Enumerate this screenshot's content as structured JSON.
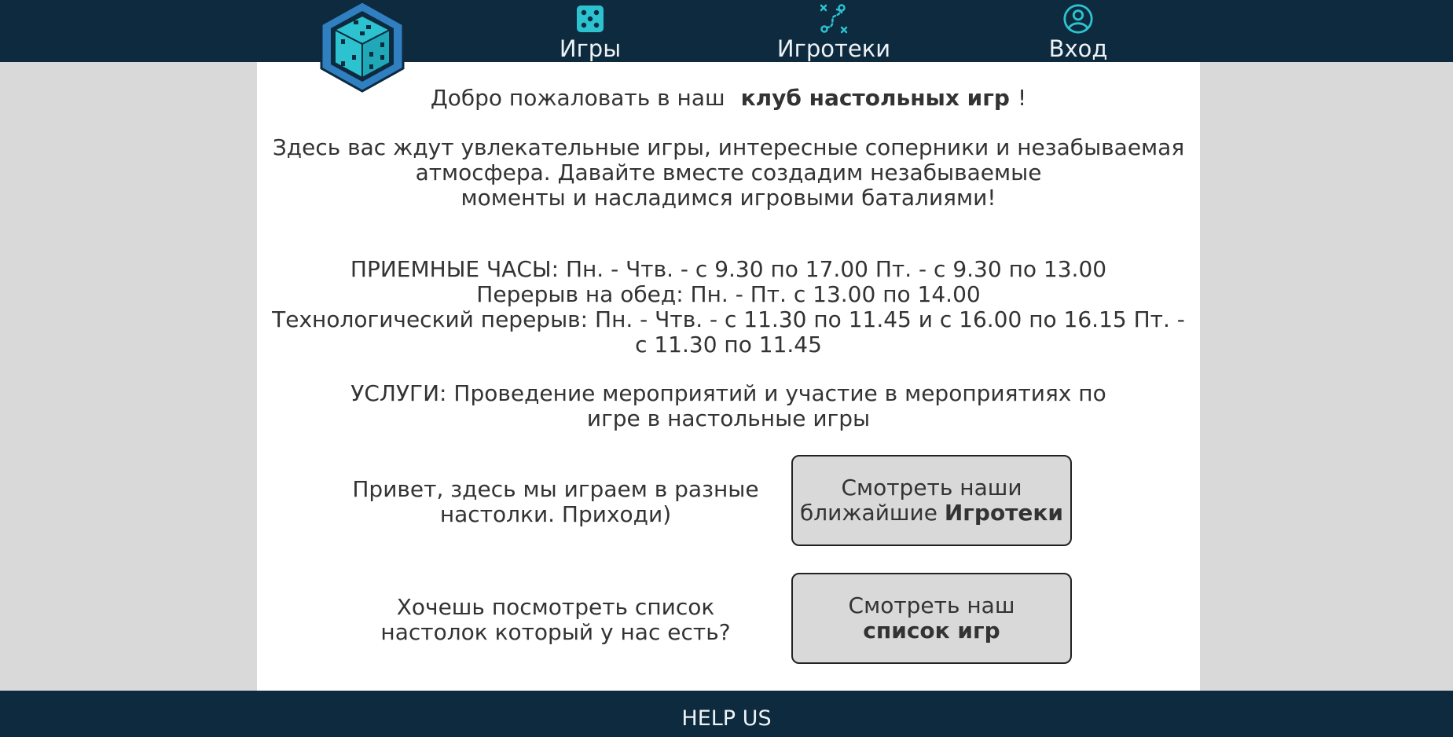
{
  "header": {
    "logo": {
      "icon": "dice-logo-icon"
    },
    "nav": {
      "games_label": "Игры",
      "games_icon": "dice-icon",
      "events_label": "Игротеки",
      "events_icon": "strategy-route-icon",
      "login_label": "Вход",
      "login_icon": "user-circle-icon"
    }
  },
  "main": {
    "welcome_prefix": "Добро пожаловать в наш",
    "welcome_bold": "клуб настольных игр",
    "welcome_suffix": "!",
    "intro_lines": [
      "Здесь вас ждут увлекательные игры, интересные соперники и незабываемая",
      "атмосфера. Давайте вместе создадим незабываемые",
      "моменты и насладимся игровыми баталиями!"
    ],
    "hours_lines": [
      "ПРИЕМНЫЕ ЧАСЫ: Пн. - Чтв. - с 9.30 по 17.00 Пт. - с 9.30 по 13.00",
      "Перерыв на обед: Пн. - Пт. с 13.00 по 14.00",
      "Технологический перерыв: Пн. - Чтв. - с 11.30 по 11.45 и с 16.00 по 16.15 Пт. -",
      "с 11.30 по 11.45"
    ],
    "services_lines": [
      "УСЛУГИ: Проведение мероприятий и участие в мероприятиях по",
      "игре в настольные игры"
    ],
    "promo1_lines": [
      "Привет, здесь мы играем в разные",
      "настолки. Приходи)"
    ],
    "promo2_lines": [
      "Хочешь посмотреть список",
      "настолок который у нас есть?"
    ],
    "cta1": {
      "line1": "Смотреть наши",
      "line2_prefix": "ближайшие ",
      "line2_bold": "Игротеки"
    },
    "cta2": {
      "line1": "Смотреть наш",
      "line2_bold": "список игр"
    }
  },
  "footer": {
    "help_label": "HELP US"
  },
  "colors": {
    "header_bg": "#0d2a3e",
    "page_bg": "#d9d9d9",
    "content_bg": "#ffffff",
    "accent_teal": "#2cc2cf",
    "logo_blue": "#2f7fc1",
    "button_bg": "#d9d9d9"
  }
}
